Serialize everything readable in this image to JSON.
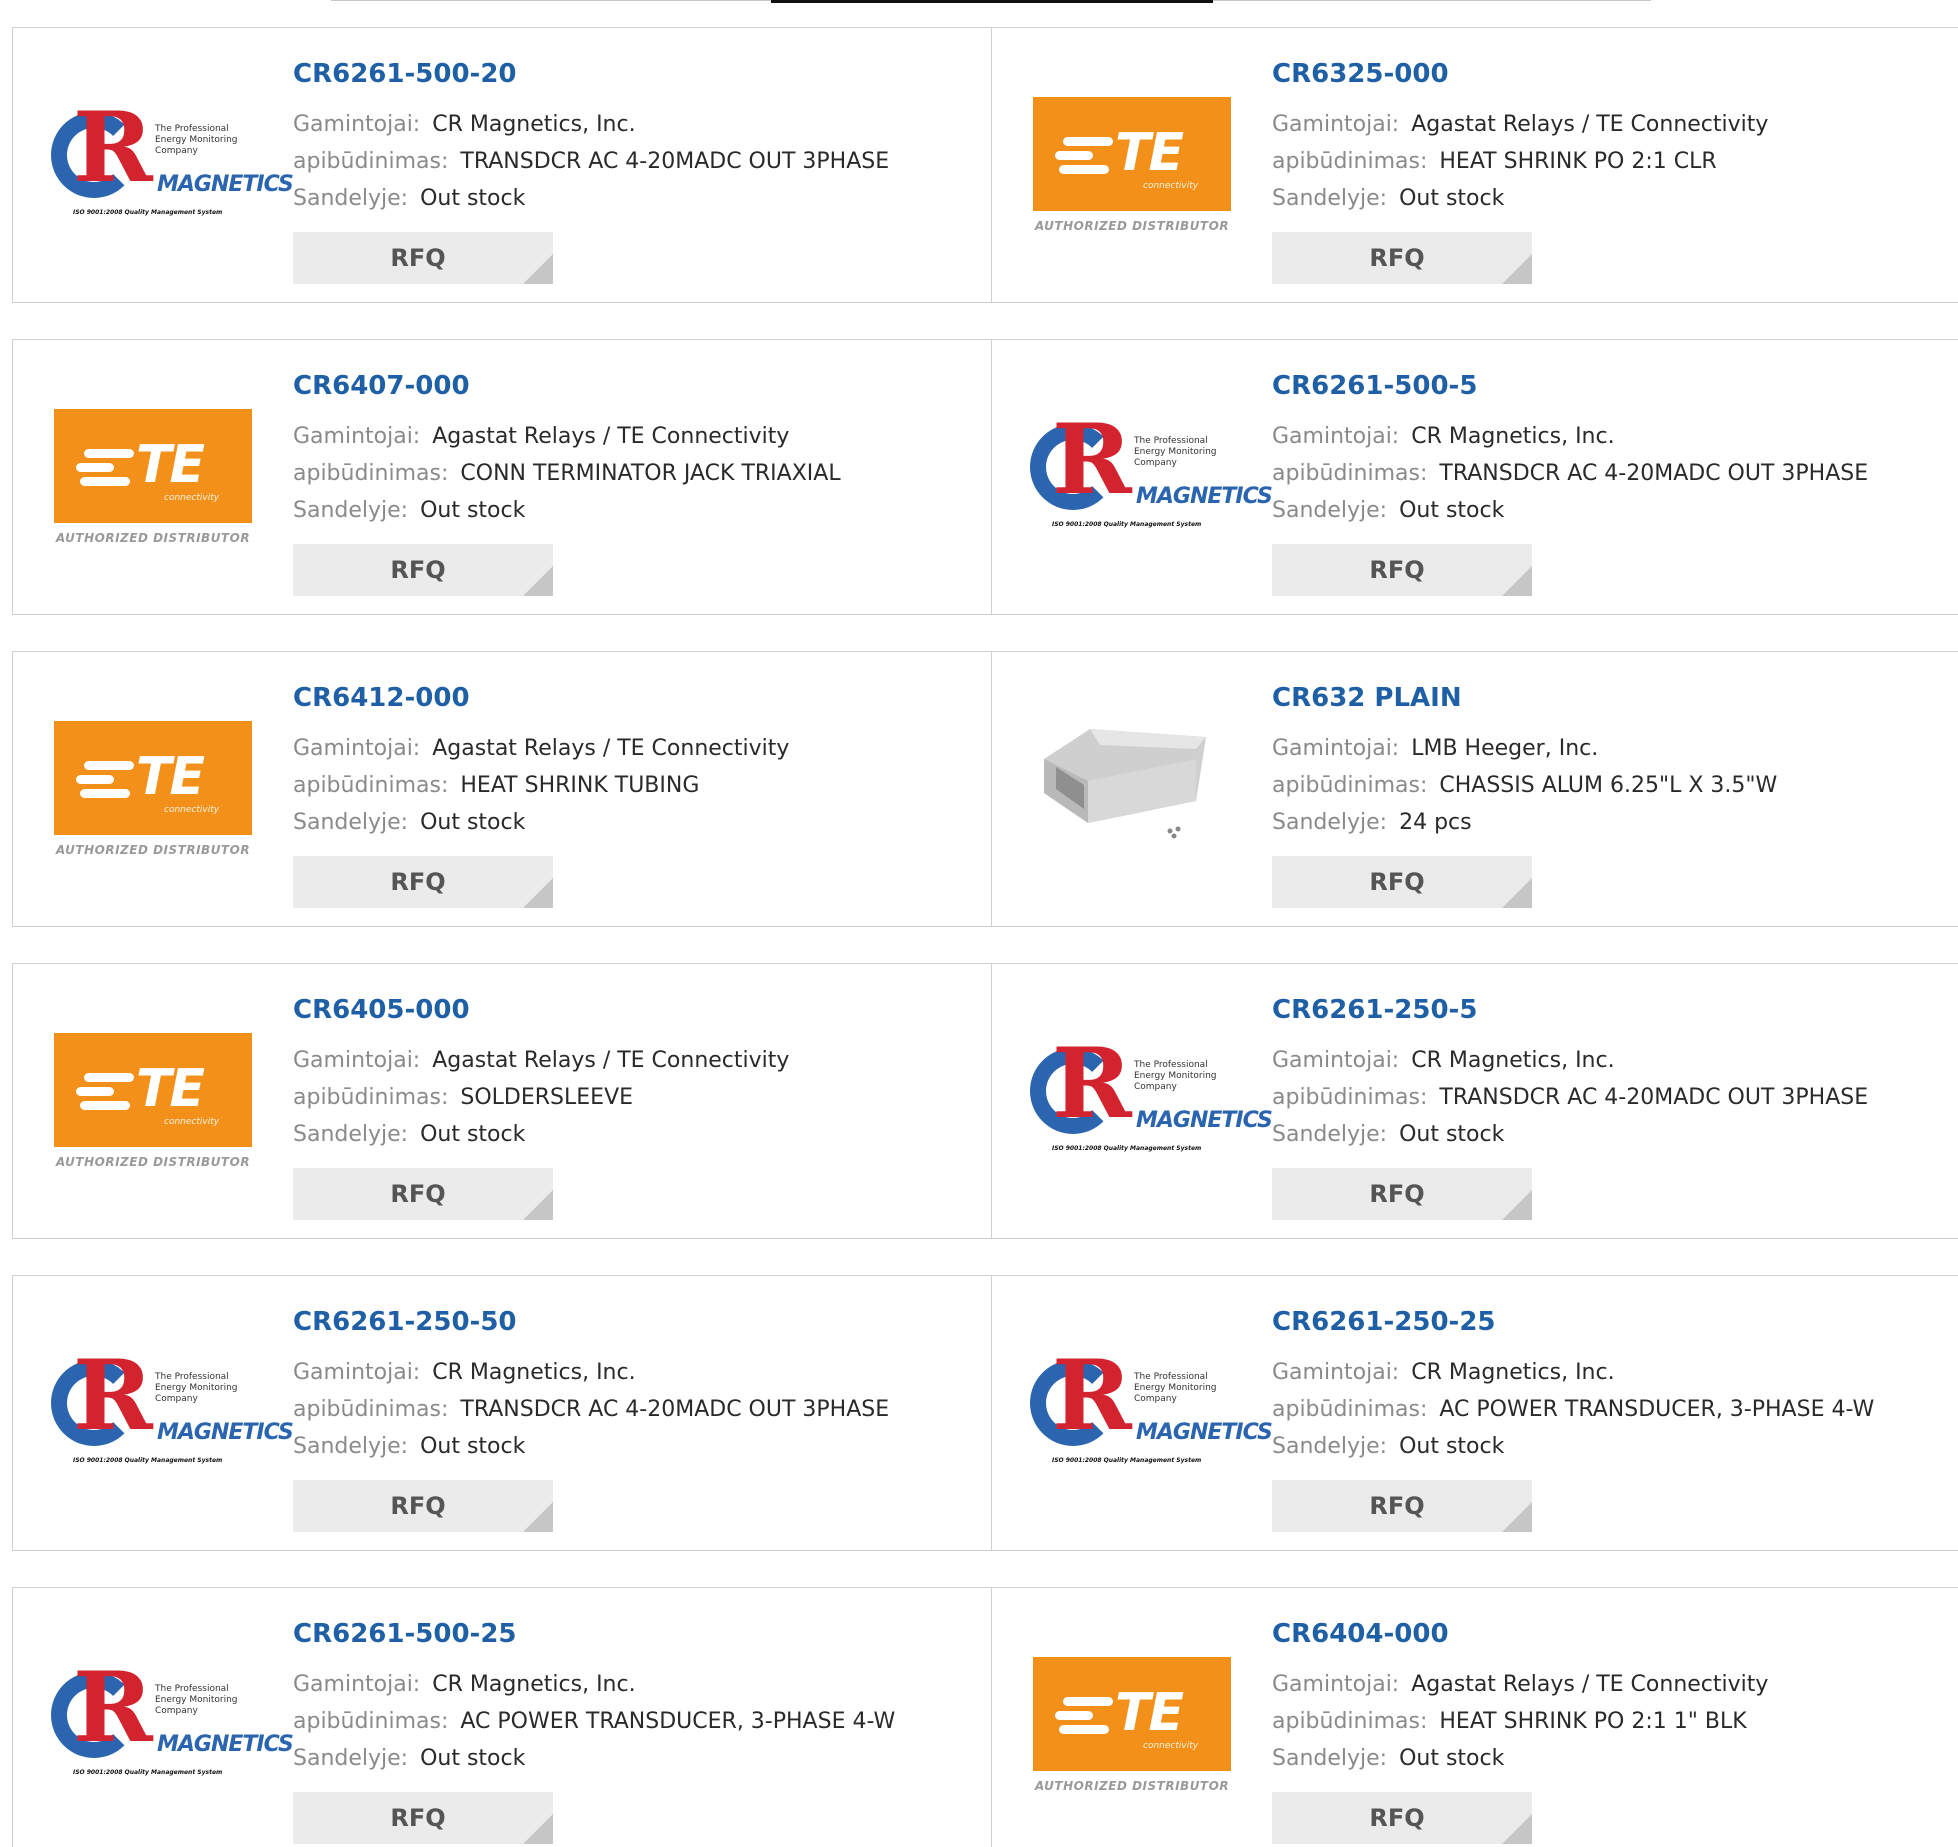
{
  "labels": {
    "manufacturer": "Gamintojai:",
    "description": "apibūdinimas:",
    "stock": "Sandelyje:"
  },
  "rfq_label": "RFQ",
  "logos": {
    "te": {
      "word": "TE",
      "sub": "connectivity",
      "authorized": "AUTHORIZED DISTRIBUTOR",
      "color": "#f39019"
    },
    "cr": {
      "tagline": [
        "The Professional",
        "Energy Monitoring",
        "Company"
      ],
      "magnetics": "MAGNETICS",
      "iso": "ISO 9001:2008 Quality Management System",
      "blue": "#2b65b0",
      "red": "#d3232f"
    }
  },
  "colors": {
    "part_link": "#1f5fa5"
  },
  "products": [
    {
      "part": "CR6261-500-20",
      "manufacturer": "CR Magnetics, Inc.",
      "description": "TRANSDCR AC 4-20MADC OUT 3PHASE",
      "stock": "Out stock",
      "logo": "cr"
    },
    {
      "part": "CR6325-000",
      "manufacturer": "Agastat Relays / TE Connectivity",
      "description": "HEAT SHRINK PO 2:1 CLR",
      "stock": "Out stock",
      "logo": "te"
    },
    {
      "part": "CR6407-000",
      "manufacturer": "Agastat Relays / TE Connectivity",
      "description": "CONN TERMINATOR JACK TRIAXIAL",
      "stock": "Out stock",
      "logo": "te"
    },
    {
      "part": "CR6261-500-5",
      "manufacturer": "CR Magnetics, Inc.",
      "description": "TRANSDCR AC 4-20MADC OUT 3PHASE",
      "stock": "Out stock",
      "logo": "cr"
    },
    {
      "part": "CR6412-000",
      "manufacturer": "Agastat Relays / TE Connectivity",
      "description": "HEAT SHRINK TUBING",
      "stock": "Out stock",
      "logo": "te"
    },
    {
      "part": "CR632 PLAIN",
      "manufacturer": "LMB Heeger, Inc.",
      "description": "CHASSIS ALUM 6.25\"L X 3.5\"W",
      "stock": "24 pcs",
      "logo": "chassis"
    },
    {
      "part": "CR6405-000",
      "manufacturer": "Agastat Relays / TE Connectivity",
      "description": "SOLDERSLEEVE",
      "stock": "Out stock",
      "logo": "te"
    },
    {
      "part": "CR6261-250-5",
      "manufacturer": "CR Magnetics, Inc.",
      "description": "TRANSDCR AC 4-20MADC OUT 3PHASE",
      "stock": "Out stock",
      "logo": "cr"
    },
    {
      "part": "CR6261-250-50",
      "manufacturer": "CR Magnetics, Inc.",
      "description": "TRANSDCR AC 4-20MADC OUT 3PHASE",
      "stock": "Out stock",
      "logo": "cr"
    },
    {
      "part": "CR6261-250-25",
      "manufacturer": "CR Magnetics, Inc.",
      "description": "AC POWER TRANSDUCER, 3-PHASE 4-W",
      "stock": "Out stock",
      "logo": "cr"
    },
    {
      "part": "CR6261-500-25",
      "manufacturer": "CR Magnetics, Inc.",
      "description": "AC POWER TRANSDUCER, 3-PHASE 4-W",
      "stock": "Out stock",
      "logo": "cr"
    },
    {
      "part": "CR6404-000",
      "manufacturer": "Agastat Relays / TE Connectivity",
      "description": "HEAT SHRINK PO 2:1 1\" BLK",
      "stock": "Out stock",
      "logo": "te"
    }
  ]
}
